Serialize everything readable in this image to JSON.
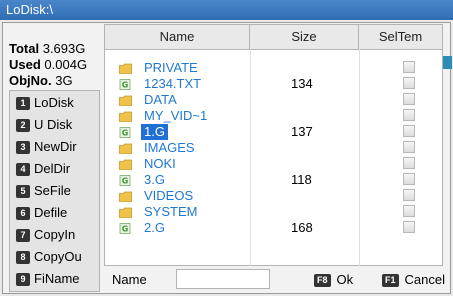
{
  "window": {
    "title": "LoDisk:\\"
  },
  "stats": {
    "total_label": "Total",
    "total_value": "3.693G",
    "used_label": "Used",
    "used_value": "0.004G",
    "objno_label": "ObjNo.",
    "objno_value": "3G"
  },
  "menu": {
    "items": [
      {
        "key": "1",
        "label": "LoDisk"
      },
      {
        "key": "2",
        "label": "U Disk"
      },
      {
        "key": "3",
        "label": "NewDir"
      },
      {
        "key": "4",
        "label": "DelDir"
      },
      {
        "key": "5",
        "label": "SeFile"
      },
      {
        "key": "6",
        "label": "Defile"
      },
      {
        "key": "7",
        "label": "CopyIn"
      },
      {
        "key": "8",
        "label": "CopyOu"
      },
      {
        "key": "9",
        "label": "FiName"
      }
    ]
  },
  "table": {
    "columns": {
      "name": "Name",
      "size": "Size",
      "sel": "SelTem"
    },
    "rows": [
      {
        "icon": "folder-icon",
        "name": "PRIVATE",
        "size": ""
      },
      {
        "icon": "file-icon",
        "name": "1234.TXT",
        "size": "134"
      },
      {
        "icon": "folder-icon",
        "name": "DATA",
        "size": ""
      },
      {
        "icon": "folder-icon",
        "name": "MY_VID~1",
        "size": ""
      },
      {
        "icon": "file-icon",
        "name": "1.G",
        "size": "137",
        "selected": true
      },
      {
        "icon": "folder-icon",
        "name": "IMAGES",
        "size": ""
      },
      {
        "icon": "folder-icon",
        "name": "NOKI",
        "size": ""
      },
      {
        "icon": "file-icon",
        "name": "3.G",
        "size": "118"
      },
      {
        "icon": "folder-icon",
        "name": "VIDEOS",
        "size": ""
      },
      {
        "icon": "folder-icon",
        "name": "SYSTEM",
        "size": ""
      },
      {
        "icon": "file-icon",
        "name": "2.G",
        "size": "168"
      }
    ]
  },
  "bottom": {
    "name_label": "Name",
    "name_value": "",
    "ok_key": "F8",
    "ok_label": "Ok",
    "cancel_key": "F1",
    "cancel_label": "Cancel"
  },
  "colors": {
    "accent": "#1f78d1",
    "selection": "#1f6fd6",
    "titlebar": "#3574bd",
    "folder": "#f0c24a",
    "file": "#3c9b3c"
  }
}
